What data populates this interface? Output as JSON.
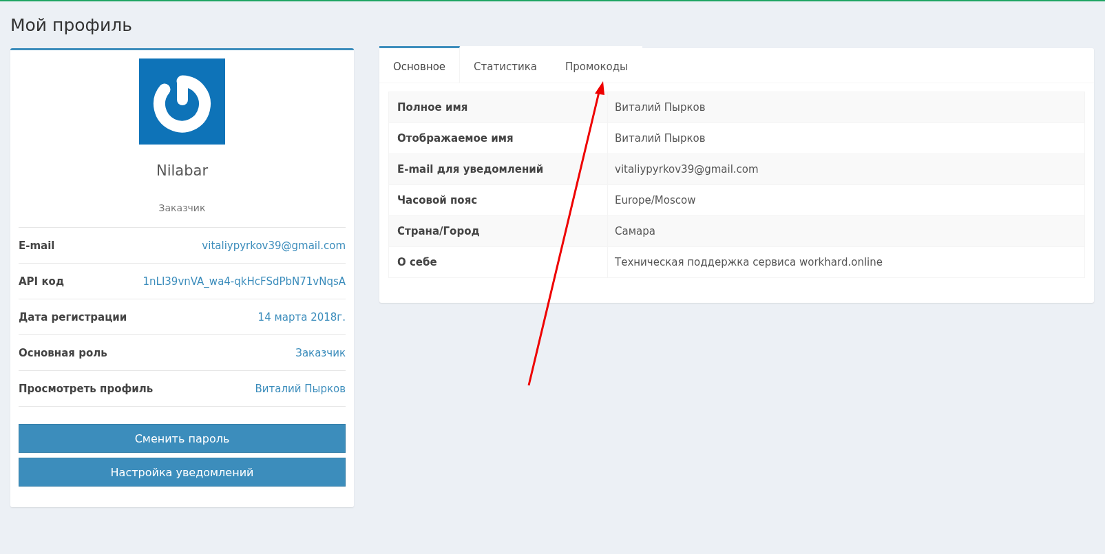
{
  "page_title": "Мой профиль",
  "profile": {
    "name": "Nilabar",
    "role": "Заказчик",
    "details": [
      {
        "label": "E-mail",
        "value": "vitaliypyrkov39@gmail.com"
      },
      {
        "label": "API код",
        "value": "1nLI39vnVA_wa4-qkHcFSdPbN71vNqsA"
      },
      {
        "label": "Дата регистрации",
        "value": "14 марта 2018г."
      },
      {
        "label": "Основная роль",
        "value": "Заказчик"
      },
      {
        "label": "Просмотреть профиль",
        "value": "Виталий Пырков"
      }
    ],
    "buttons": [
      "Сменить пароль",
      "Настройка уведомлений"
    ]
  },
  "tabs": [
    {
      "label": "Основное",
      "selected": true
    },
    {
      "label": "Статистика",
      "selected": false
    },
    {
      "label": "Промокоды",
      "selected": false
    }
  ],
  "info_table": [
    {
      "label": "Полное имя",
      "value": "Виталий Пырков"
    },
    {
      "label": "Отображаемое имя",
      "value": "Виталий Пырков"
    },
    {
      "label": "E-mail для уведомлений",
      "value": "vitaliypyrkov39@gmail.com"
    },
    {
      "label": "Часовой пояс",
      "value": "Europe/Moscow"
    },
    {
      "label": "Страна/Город",
      "value": "Самара"
    },
    {
      "label": "О себе",
      "value": "Техническая поддержка сервиса workhard.online"
    }
  ]
}
